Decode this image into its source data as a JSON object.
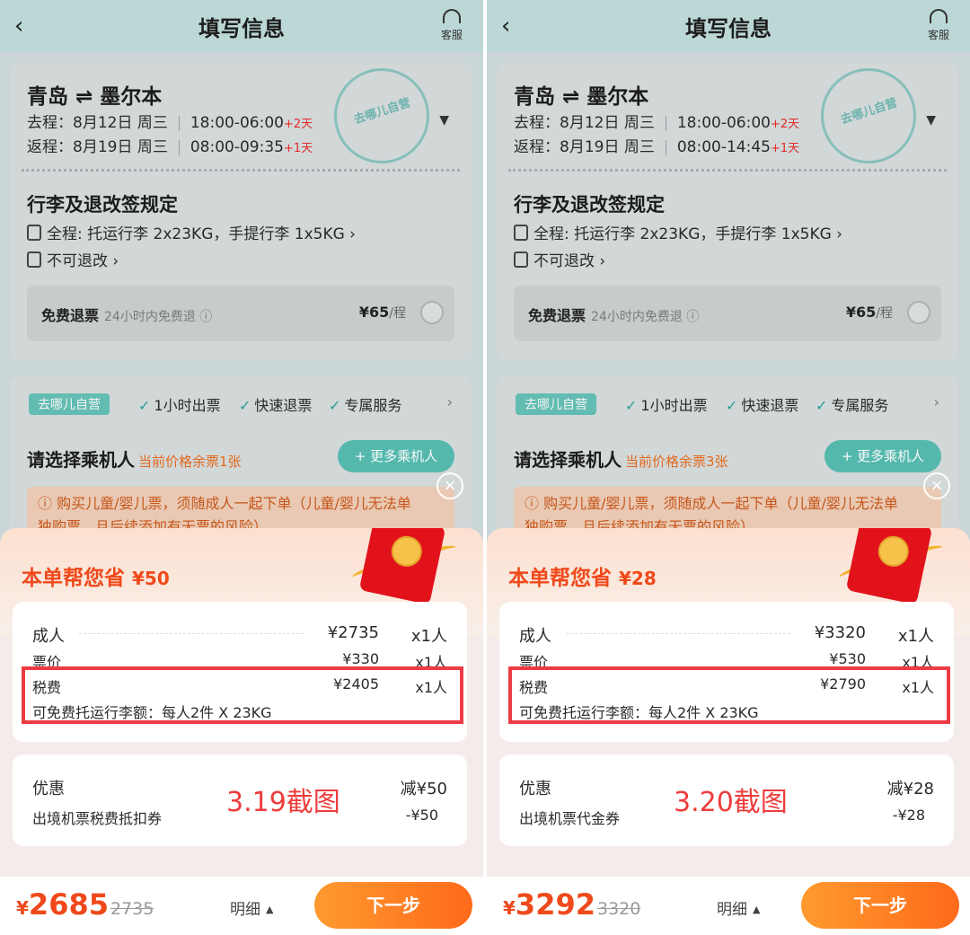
{
  "panels": [
    {
      "header": {
        "title": "填写信息",
        "service": "客服"
      },
      "trip": {
        "route": "青岛 ⇌ 墨尔本",
        "outbound": {
          "label": "去程：8月12日 周三",
          "time": "18:00-06:00",
          "plus": "+2天"
        },
        "return": {
          "label": "返程：8月19日 周三",
          "time": "08:00-09:35",
          "plus": "+1天"
        },
        "stamp": "去哪儿自营"
      },
      "baggage": {
        "title": "行李及退改签规定",
        "allowance": "全程: 托运行李 2x23KG，手提行李 1x5KG ›",
        "refund_rule": "不可退改 ›",
        "free_refund": {
          "label": "免费退票",
          "sub": "24小时内免费退 ⓘ",
          "price": "¥65",
          "unit": "/程"
        }
      },
      "service": {
        "badge": "去哪儿自营",
        "features": [
          "1小时出票",
          "快速退票",
          "专属服务"
        ],
        "passenger_title": "请选择乘机人",
        "remaining": "当前价格余票1张",
        "more_button": "+ 更多乘机人",
        "warning": "ⓘ 购买儿童/婴儿票，须随成人一起下单（儿童/婴儿无法单独购票，且后续添加有无票的风险）"
      },
      "popup": {
        "savings_label": "本单帮您省",
        "savings_amount": "¥50",
        "adult": {
          "label": "成人",
          "value": "¥2735",
          "qty": "x1人"
        },
        "ticket": {
          "label": "票价",
          "value": "¥330",
          "qty": "x1人"
        },
        "tax": {
          "label": "税费",
          "value": "¥2405",
          "qty": "x1人"
        },
        "baggage": "可免费托运行李额：每人2件 X 23KG",
        "discount": {
          "label": "优惠",
          "value": "减¥50"
        },
        "coupon": {
          "label": "出境机票税费抵扣券",
          "value": "-¥50"
        },
        "note": "3.19截图"
      },
      "bottom": {
        "currency": "¥",
        "total": "2685",
        "original": "2735",
        "detail": "明细",
        "next": "下一步"
      }
    },
    {
      "header": {
        "title": "填写信息",
        "service": "客服"
      },
      "trip": {
        "route": "青岛 ⇌ 墨尔本",
        "outbound": {
          "label": "去程：8月12日 周三",
          "time": "18:00-06:00",
          "plus": "+2天"
        },
        "return": {
          "label": "返程：8月19日 周三",
          "time": "08:00-14:45",
          "plus": "+1天"
        },
        "stamp": "去哪儿自营"
      },
      "baggage": {
        "title": "行李及退改签规定",
        "allowance": "全程: 托运行李 2x23KG，手提行李 1x5KG ›",
        "refund_rule": "不可退改 ›",
        "free_refund": {
          "label": "免费退票",
          "sub": "24小时内免费退 ⓘ",
          "price": "¥65",
          "unit": "/程"
        }
      },
      "service": {
        "badge": "去哪儿自营",
        "features": [
          "1小时出票",
          "快速退票",
          "专属服务"
        ],
        "passenger_title": "请选择乘机人",
        "remaining": "当前价格余票3张",
        "more_button": "+ 更多乘机人",
        "warning": "ⓘ 购买儿童/婴儿票，须随成人一起下单（儿童/婴儿无法单独购票，且后续添加有无票的风险）"
      },
      "popup": {
        "savings_label": "本单帮您省",
        "savings_amount": "¥28",
        "adult": {
          "label": "成人",
          "value": "¥3320",
          "qty": "x1人"
        },
        "ticket": {
          "label": "票价",
          "value": "¥530",
          "qty": "x1人"
        },
        "tax": {
          "label": "税费",
          "value": "¥2790",
          "qty": "x1人"
        },
        "baggage": "可免费托运行李额：每人2件 X 23KG",
        "discount": {
          "label": "优惠",
          "value": "减¥28"
        },
        "coupon": {
          "label": "出境机票代金券",
          "value": "-¥28"
        },
        "note": "3.20截图"
      },
      "bottom": {
        "currency": "¥",
        "total": "3292",
        "original": "3320",
        "detail": "明细",
        "next": "下一步"
      }
    }
  ]
}
